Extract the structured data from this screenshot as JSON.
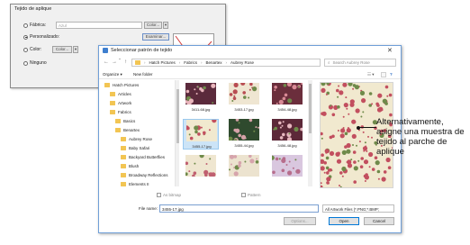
{
  "back_dialog": {
    "title": "Tejido de aplique",
    "options": [
      {
        "label": "Fábrica:",
        "selected": false,
        "value": "Azul",
        "button": "Color..."
      },
      {
        "label": "Personalizado:",
        "selected": true,
        "button": "Examinar..."
      },
      {
        "label": "Color:",
        "selected": false,
        "button": "Color..."
      },
      {
        "label": "Ninguno",
        "selected": false
      }
    ]
  },
  "front_dialog": {
    "title": "Seleccionar patrón de tejido",
    "close_glyph": "✕",
    "breadcrumb": [
      "Hatch Pictures",
      "Fabrics",
      "Benartex",
      "Aubrey Rose"
    ],
    "search_placeholder": "Search Aubrey Rose",
    "toolbar": {
      "organize": "Organize ▾",
      "new_folder": "New folder"
    },
    "tree": [
      {
        "label": "Hatch Pictures",
        "level": 0
      },
      {
        "label": "Articles",
        "level": 1
      },
      {
        "label": "Artwork",
        "level": 1
      },
      {
        "label": "Fabrics",
        "level": 1
      },
      {
        "label": "Basics",
        "level": 2
      },
      {
        "label": "Benartex",
        "level": 2
      },
      {
        "label": "Aubrey Rose",
        "level": 3
      },
      {
        "label": "Baby Safari",
        "level": 3
      },
      {
        "label": "Backyard Butterflies",
        "level": 3
      },
      {
        "label": "Blush",
        "level": 3
      },
      {
        "label": "Broadway Reflections",
        "level": 3
      },
      {
        "label": "Elements II",
        "level": 3
      }
    ],
    "thumbnails": [
      {
        "name": "3411-68.jpg",
        "bg": "#5b2a3c",
        "fg": "#e9b6bd",
        "selected": false
      },
      {
        "name": "3453-17.jpg",
        "bg": "#efe6d2",
        "fg": "#b84c52",
        "selected": false
      },
      {
        "name": "3454-48.jpg",
        "bg": "#6b2e3c",
        "fg": "#d98a96",
        "selected": false
      },
      {
        "name": "3455-17.jpg",
        "bg": "#f1e9cf",
        "fg": "#c24f5f",
        "selected": true
      },
      {
        "name": "3455-44.jpg",
        "bg": "#2f4a2e",
        "fg": "#d6a2a8",
        "selected": false
      },
      {
        "name": "3456-48.jpg",
        "bg": "#5c2838",
        "fg": "#e7b7bf",
        "selected": false
      },
      {
        "name": "",
        "bg": "#efe6d0",
        "fg": "#c06070",
        "selected": false
      },
      {
        "name": "",
        "bg": "#ece3cf",
        "fg": "#d6a4ac",
        "selected": false
      },
      {
        "name": "",
        "bg": "#d9c7df",
        "fg": "#b76d8c",
        "selected": false
      }
    ],
    "checkbox_as_bitmap": "As bitmap",
    "checkbox_pattern": "Pattern",
    "file_name_label": "File name:",
    "file_name_value": "3455-17.jpg",
    "file_type": "All Artwork Files (*.PNG;*.BMP;",
    "buttons": {
      "options": "Options...",
      "open": "Open",
      "cancel": "Cancel"
    }
  },
  "annotation": "Alternativamente, asigne una muestra de tejido al parche de aplique",
  "colors": {
    "accent": "#0078d7",
    "folder": "#f2c553",
    "fabric_bg": "#f1e9cf",
    "rose": "#c24f5f"
  }
}
